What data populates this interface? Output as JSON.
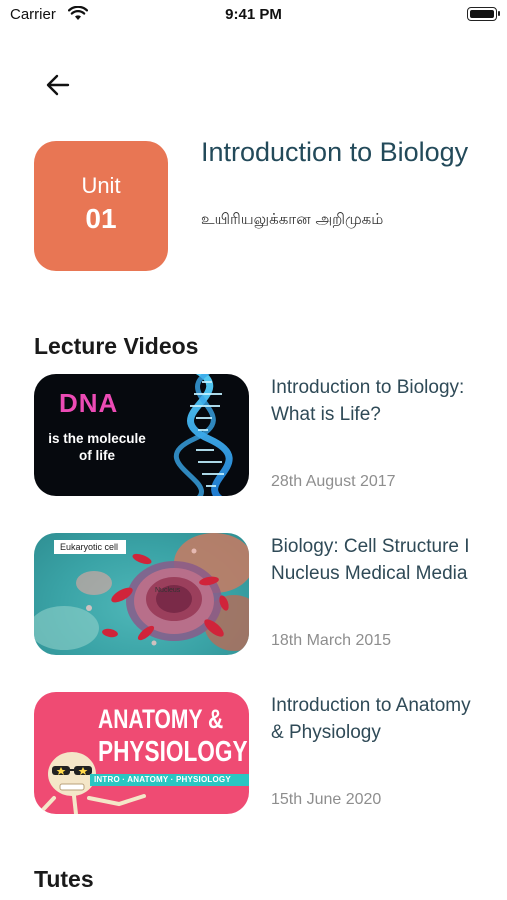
{
  "status_bar": {
    "carrier": "Carrier",
    "time": "9:41 PM"
  },
  "unit": {
    "word": "Unit",
    "number": "01",
    "title": "Introduction to Biology",
    "subtitle": "உயிரியலுக்கான அறிமுகம்",
    "badge_color": "#e87654"
  },
  "sections": {
    "lecture_videos": "Lecture Videos",
    "tutes": "Tutes"
  },
  "videos": [
    {
      "title": "Introduction to Biology: What is Life?",
      "date": "28th August 2017",
      "thumb_text": "DNA",
      "thumb_caption": "is the molecule of life"
    },
    {
      "title": "Biology: Cell Structure I Nucleus Medical Media",
      "date": "18th March 2015",
      "thumb_text": "Eukaryotic cell",
      "thumb_caption": "Nucleus"
    },
    {
      "title": "Introduction to Anatomy & Physiology",
      "date": "15th June 2020",
      "thumb_text_line1": "ANATOMY &",
      "thumb_text_line2": "PHYSIOLOGY",
      "thumb_strip": "INTRO · ANATOMY · PHYSIOLOGY"
    }
  ],
  "colors": {
    "title_text": "#234a5a",
    "video_title_text": "#2f4a57",
    "date_text": "#8e8e8e"
  }
}
